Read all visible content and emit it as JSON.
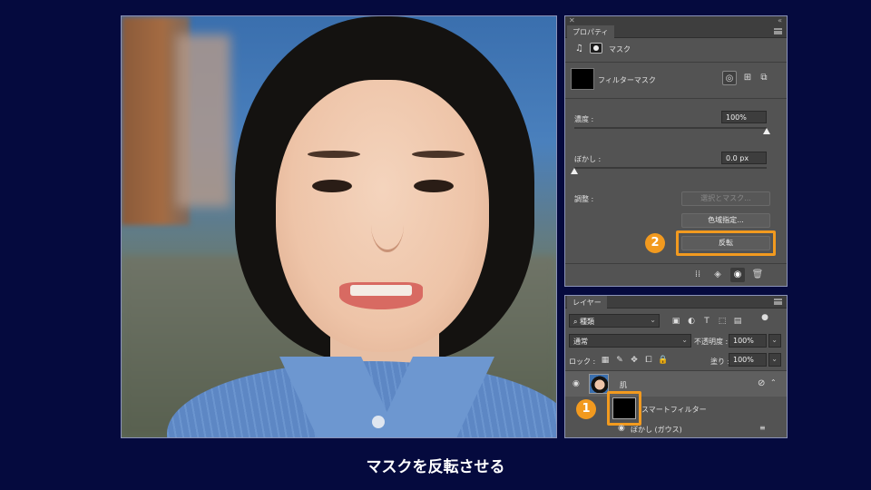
{
  "properties_panel": {
    "tab_label": "プロパティ",
    "mask_header_label": "マスク",
    "filter_mask_label": "フィルターマスク",
    "density_label": "濃度 :",
    "density_value": "100%",
    "feather_label": "ぼかし :",
    "feather_value": "0.0 px",
    "adjust_label": "調整 :",
    "select_and_mask_button": "選択とマスク...",
    "color_range_button": "色域指定...",
    "invert_button": "反転",
    "density_level": 1.0,
    "feather_level": 0.0
  },
  "layers_panel": {
    "tab_label": "レイヤー",
    "filter_kind_value": "種類",
    "blend_mode_value": "通常",
    "opacity_label": "不透明度 :",
    "opacity_value": "100%",
    "lock_label": "ロック :",
    "fill_label": "塗り :",
    "fill_value": "100%",
    "layers": [
      {
        "name": "肌"
      },
      {
        "name": "スマートフィルター"
      },
      {
        "name": "ぼかし (ガウス)"
      }
    ]
  },
  "callouts": {
    "step1": "1",
    "step2": "2"
  },
  "caption": "マスクを反転させる",
  "colors": {
    "background": "#050a3e",
    "highlight": "#f29a1f",
    "panel": "#535353"
  }
}
